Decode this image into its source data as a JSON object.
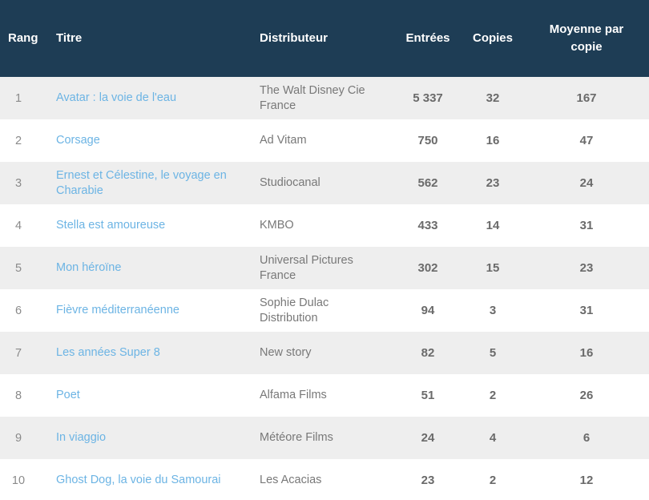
{
  "table": {
    "columns": {
      "rang": "Rang",
      "titre": "Titre",
      "distributeur": "Distributeur",
      "entrees": "Entrées",
      "copies": "Copies",
      "moyenne": "Moyenne par copie"
    },
    "colors": {
      "header_background": "#1e3d55",
      "header_text": "#ffffff",
      "row_odd_background": "#eeeeee",
      "row_even_background": "#ffffff",
      "link": "#6cb4e4",
      "body_text": "#6d6d6d"
    },
    "rows": [
      {
        "rang": "1",
        "titre": "Avatar : la voie de l'eau",
        "distributeur": "The Walt Disney Cie France",
        "entrees": "5 337",
        "copies": "32",
        "moyenne": "167"
      },
      {
        "rang": "2",
        "titre": "Corsage",
        "distributeur": "Ad Vitam",
        "entrees": "750",
        "copies": "16",
        "moyenne": "47"
      },
      {
        "rang": "3",
        "titre": "Ernest et Célestine, le voyage en Charabie",
        "distributeur": "Studiocanal",
        "entrees": "562",
        "copies": "23",
        "moyenne": "24"
      },
      {
        "rang": "4",
        "titre": "Stella est amoureuse",
        "distributeur": "KMBO",
        "entrees": "433",
        "copies": "14",
        "moyenne": "31"
      },
      {
        "rang": "5",
        "titre": "Mon héroïne",
        "distributeur": "Universal Pictures France",
        "entrees": "302",
        "copies": "15",
        "moyenne": "23"
      },
      {
        "rang": "6",
        "titre": "Fièvre méditerranéenne",
        "distributeur": "Sophie Dulac Distribution",
        "entrees": "94",
        "copies": "3",
        "moyenne": "31"
      },
      {
        "rang": "7",
        "titre": "Les années Super 8",
        "distributeur": "New story",
        "entrees": "82",
        "copies": "5",
        "moyenne": "16"
      },
      {
        "rang": "8",
        "titre": "Poet",
        "distributeur": "Alfama Films",
        "entrees": "51",
        "copies": "2",
        "moyenne": "26"
      },
      {
        "rang": "9",
        "titre": "In viaggio",
        "distributeur": "Météore Films",
        "entrees": "24",
        "copies": "4",
        "moyenne": "6"
      },
      {
        "rang": "10",
        "titre": "Ghost Dog, la voie du Samourai",
        "distributeur": "Les Acacias",
        "entrees": "23",
        "copies": "2",
        "moyenne": "12"
      }
    ]
  }
}
